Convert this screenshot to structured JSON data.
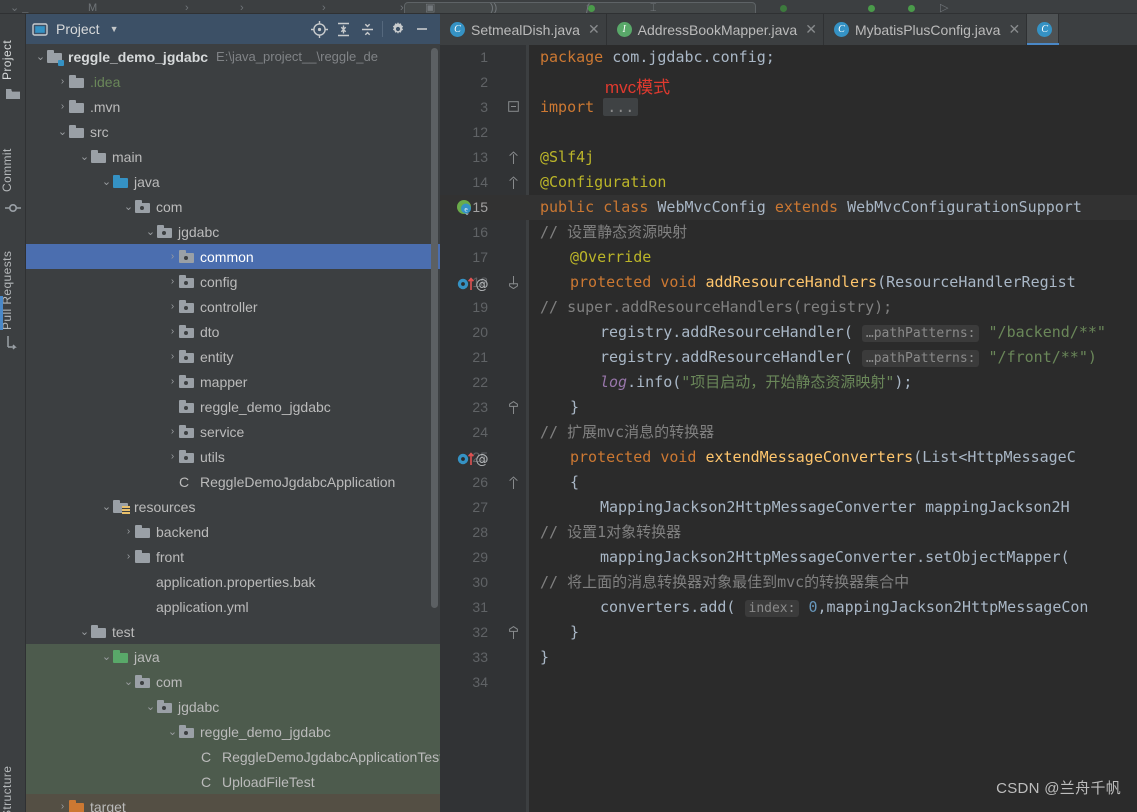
{
  "top_toolbar": {
    "search_placeholder": ""
  },
  "tool_strip": {
    "left_items": [
      {
        "label": "Project",
        "icon": "project-folder-icon",
        "active": true
      },
      {
        "label": "Commit",
        "icon": "commit-icon",
        "active": false
      },
      {
        "label": "Pull Requests",
        "icon": "pull-request-icon",
        "active": false
      }
    ],
    "bottom_items": [
      {
        "label": "Structure",
        "icon": "structure-icon",
        "active": false
      }
    ]
  },
  "project_panel": {
    "title": "Project",
    "caret_icon": "chevron-down-icon",
    "toolbar": [
      {
        "name": "select-opened-file-icon",
        "label": "Select Opened File"
      },
      {
        "name": "expand-all-icon",
        "label": "Expand All"
      },
      {
        "name": "collapse-all-icon",
        "label": "Collapse All"
      },
      {
        "name": "gear-icon",
        "label": "Options"
      },
      {
        "name": "hide-icon",
        "label": "Hide"
      }
    ],
    "tree": [
      {
        "depth": 0,
        "arrow": "down",
        "icon": "module-folder",
        "label": "reggle_demo_jgdabc",
        "bold": true,
        "path": "E:\\java_project__\\reggle_de",
        "tint": ""
      },
      {
        "depth": 1,
        "arrow": "right",
        "icon": "folder",
        "label": ".idea",
        "green": true,
        "tint": ""
      },
      {
        "depth": 1,
        "arrow": "right",
        "icon": "folder",
        "label": ".mvn",
        "tint": ""
      },
      {
        "depth": 1,
        "arrow": "down",
        "icon": "folder",
        "label": "src",
        "tint": ""
      },
      {
        "depth": 2,
        "arrow": "down",
        "icon": "folder",
        "label": "main",
        "tint": ""
      },
      {
        "depth": 3,
        "arrow": "down",
        "icon": "folder-blue",
        "label": "java",
        "tint": ""
      },
      {
        "depth": 4,
        "arrow": "down",
        "icon": "package",
        "label": "com",
        "tint": ""
      },
      {
        "depth": 5,
        "arrow": "down",
        "icon": "package",
        "label": "jgdabc",
        "tint": ""
      },
      {
        "depth": 6,
        "arrow": "right",
        "icon": "package",
        "label": "common",
        "selected": true,
        "tint": ""
      },
      {
        "depth": 6,
        "arrow": "right",
        "icon": "package",
        "label": "config",
        "tint": ""
      },
      {
        "depth": 6,
        "arrow": "right",
        "icon": "package",
        "label": "controller",
        "tint": ""
      },
      {
        "depth": 6,
        "arrow": "right",
        "icon": "package",
        "label": "dto",
        "tint": ""
      },
      {
        "depth": 6,
        "arrow": "right",
        "icon": "package",
        "label": "entity",
        "tint": ""
      },
      {
        "depth": 6,
        "arrow": "right",
        "icon": "package",
        "label": "mapper",
        "tint": ""
      },
      {
        "depth": 6,
        "arrow": "none",
        "icon": "package",
        "label": "reggle_demo_jgdabc",
        "tint": ""
      },
      {
        "depth": 6,
        "arrow": "right",
        "icon": "package",
        "label": "service",
        "tint": ""
      },
      {
        "depth": 6,
        "arrow": "right",
        "icon": "package",
        "label": "utils",
        "tint": ""
      },
      {
        "depth": 6,
        "arrow": "none",
        "icon": "spring-class",
        "label": "ReggleDemoJgdabcApplication",
        "tint": ""
      },
      {
        "depth": 3,
        "arrow": "down",
        "icon": "resources",
        "label": "resources",
        "tint": ""
      },
      {
        "depth": 4,
        "arrow": "right",
        "icon": "folder",
        "label": "backend",
        "tint": ""
      },
      {
        "depth": 4,
        "arrow": "right",
        "icon": "folder",
        "label": "front",
        "tint": ""
      },
      {
        "depth": 4,
        "arrow": "none",
        "icon": "properties",
        "label": "application.properties.bak",
        "tint": ""
      },
      {
        "depth": 4,
        "arrow": "none",
        "icon": "yaml",
        "label": "application.yml",
        "tint": ""
      },
      {
        "depth": 2,
        "arrow": "down",
        "icon": "folder",
        "label": "test",
        "tint": ""
      },
      {
        "depth": 3,
        "arrow": "down",
        "icon": "folder-green",
        "label": "java",
        "tint": "green"
      },
      {
        "depth": 4,
        "arrow": "down",
        "icon": "package",
        "label": "com",
        "tint": "green"
      },
      {
        "depth": 5,
        "arrow": "down",
        "icon": "package",
        "label": "jgdabc",
        "tint": "green"
      },
      {
        "depth": 6,
        "arrow": "down",
        "icon": "package",
        "label": "reggle_demo_jgdabc",
        "tint": "green"
      },
      {
        "depth": 7,
        "arrow": "none",
        "icon": "test-class",
        "label": "ReggleDemoJgdabcApplicationTests",
        "tint": "green"
      },
      {
        "depth": 7,
        "arrow": "none",
        "icon": "test-class",
        "label": "UploadFileTest",
        "tint": "green"
      },
      {
        "depth": 1,
        "arrow": "right",
        "icon": "folder-orange",
        "label": "target",
        "orange": true,
        "tint": "brown"
      }
    ]
  },
  "editor": {
    "tabs": [
      {
        "label": "SetmealDish.java",
        "icon": "java-class-icon",
        "active": false,
        "close_icon": "close-icon"
      },
      {
        "label": "AddressBookMapper.java",
        "icon": "java-interface-icon",
        "active": false,
        "close_icon": "close-icon"
      },
      {
        "label": "MybatisPlusConfig.java",
        "icon": "java-class-icon",
        "active": false,
        "close_icon": "close-icon"
      },
      {
        "label": "",
        "icon": "java-class-icon",
        "active": true,
        "close_icon": "close-icon"
      }
    ],
    "annotation": "mvc模式",
    "annotation_color": "#e03a2f",
    "lines": [
      {
        "num": "1",
        "indent": 0,
        "tokens": [
          {
            "t": "package ",
            "c": "kw"
          },
          {
            "t": "com.jgdabc.config;",
            "c": "pln"
          }
        ]
      },
      {
        "num": "2",
        "indent": 0,
        "tokens": []
      },
      {
        "num": "3",
        "indent": 0,
        "fold": "minus",
        "tokens": [
          {
            "t": "import ",
            "c": "kw"
          },
          {
            "t": "...",
            "c": "fold"
          }
        ]
      },
      {
        "num": "12",
        "indent": 0,
        "tokens": []
      },
      {
        "num": "13",
        "indent": 0,
        "fold": "top",
        "tokens": [
          {
            "t": "@Slf4j",
            "c": "anno"
          }
        ]
      },
      {
        "num": "14",
        "indent": 0,
        "fold": "top",
        "tokens": [
          {
            "t": "@Configuration",
            "c": "anno"
          }
        ]
      },
      {
        "num": "15",
        "indent": 0,
        "current": true,
        "gutter": "spring-bean-icon",
        "tokens": [
          {
            "t": "public ",
            "c": "kw"
          },
          {
            "t": "class ",
            "c": "kw"
          },
          {
            "t": "WebMvcConfig ",
            "c": "typ"
          },
          {
            "t": "extends ",
            "c": "kw"
          },
          {
            "t": "WebMvcConfigurationSupport",
            "c": "typ"
          }
        ]
      },
      {
        "num": "16",
        "indent": 0,
        "tokens": [
          {
            "t": "//    设置静态资源映射",
            "c": "cmt"
          }
        ]
      },
      {
        "num": "17",
        "indent": 1,
        "tokens": [
          {
            "t": "@Override",
            "c": "anno"
          }
        ]
      },
      {
        "num": "18",
        "indent": 1,
        "gutter": "overridden-method-icon",
        "fold": "bottom",
        "tokens": [
          {
            "t": "protected ",
            "c": "kw"
          },
          {
            "t": "void ",
            "c": "kw"
          },
          {
            "t": "addResourceHandlers",
            "c": "mth"
          },
          {
            "t": "(ResourceHandlerRegist",
            "c": "pln"
          }
        ]
      },
      {
        "num": "19",
        "indent": 0,
        "tokens": [
          {
            "t": "//       super.addResourceHandlers(registry);",
            "c": "cmt"
          }
        ]
      },
      {
        "num": "20",
        "indent": 2,
        "tokens": [
          {
            "t": "registry.addResourceHandler( ",
            "c": "pln"
          },
          {
            "t": "…pathPatterns:",
            "c": "hint"
          },
          {
            "t": " ",
            "c": "pln"
          },
          {
            "t": "\"/backend/**\"",
            "c": "str"
          }
        ]
      },
      {
        "num": "21",
        "indent": 2,
        "tokens": [
          {
            "t": "registry.addResourceHandler( ",
            "c": "pln"
          },
          {
            "t": "…pathPatterns:",
            "c": "hint"
          },
          {
            "t": " ",
            "c": "pln"
          },
          {
            "t": "\"/front/**\")",
            "c": "str"
          }
        ]
      },
      {
        "num": "22",
        "indent": 2,
        "tokens": [
          {
            "t": "log",
            "c": "fld"
          },
          {
            "t": ".info(",
            "c": "pln"
          },
          {
            "t": "\"项目启动，开始静态资源映射\"",
            "c": "str"
          },
          {
            "t": ");",
            "c": "pln"
          }
        ]
      },
      {
        "num": "23",
        "indent": 1,
        "fold": "end",
        "tokens": [
          {
            "t": "}",
            "c": "pln"
          }
        ]
      },
      {
        "num": "24",
        "indent": 0,
        "tokens": [
          {
            "t": "//    扩展mvc消息的转换器",
            "c": "cmt"
          }
        ]
      },
      {
        "num": "25",
        "indent": 1,
        "gutter": "overridden-method-icon",
        "tokens": [
          {
            "t": "protected ",
            "c": "kw"
          },
          {
            "t": "void ",
            "c": "kw"
          },
          {
            "t": "extendMessageConverters",
            "c": "mth"
          },
          {
            "t": "(List<HttpMessageC",
            "c": "pln"
          }
        ]
      },
      {
        "num": "26",
        "indent": 1,
        "fold": "top",
        "tokens": [
          {
            "t": "{",
            "c": "pln"
          }
        ]
      },
      {
        "num": "27",
        "indent": 2,
        "tokens": [
          {
            "t": "MappingJackson2HttpMessageConverter mappingJackson2H",
            "c": "pln"
          }
        ]
      },
      {
        "num": "28",
        "indent": 0,
        "tokens": [
          {
            "t": "//      设置1对象转换器",
            "c": "cmt"
          }
        ]
      },
      {
        "num": "29",
        "indent": 2,
        "tokens": [
          {
            "t": "mappingJackson2HttpMessageConverter.setObjectMapper(",
            "c": "pln"
          }
        ]
      },
      {
        "num": "30",
        "indent": 0,
        "tokens": [
          {
            "t": "//      将上面的消息转换器对象最佳到mvc的转换器集合中",
            "c": "cmt"
          }
        ]
      },
      {
        "num": "31",
        "indent": 2,
        "tokens": [
          {
            "t": "converters.add( ",
            "c": "pln"
          },
          {
            "t": "index:",
            "c": "hint"
          },
          {
            "t": " ",
            "c": "pln"
          },
          {
            "t": "0",
            "c": "num"
          },
          {
            "t": ",mappingJackson2HttpMessageCon",
            "c": "pln"
          }
        ]
      },
      {
        "num": "32",
        "indent": 1,
        "fold": "end",
        "tokens": [
          {
            "t": "}",
            "c": "pln"
          }
        ]
      },
      {
        "num": "33",
        "indent": 0,
        "tokens": [
          {
            "t": "}",
            "c": "pln"
          }
        ]
      },
      {
        "num": "34",
        "indent": 0,
        "tokens": []
      }
    ]
  },
  "watermark": {
    "text": "CSDN @兰舟千帆"
  }
}
